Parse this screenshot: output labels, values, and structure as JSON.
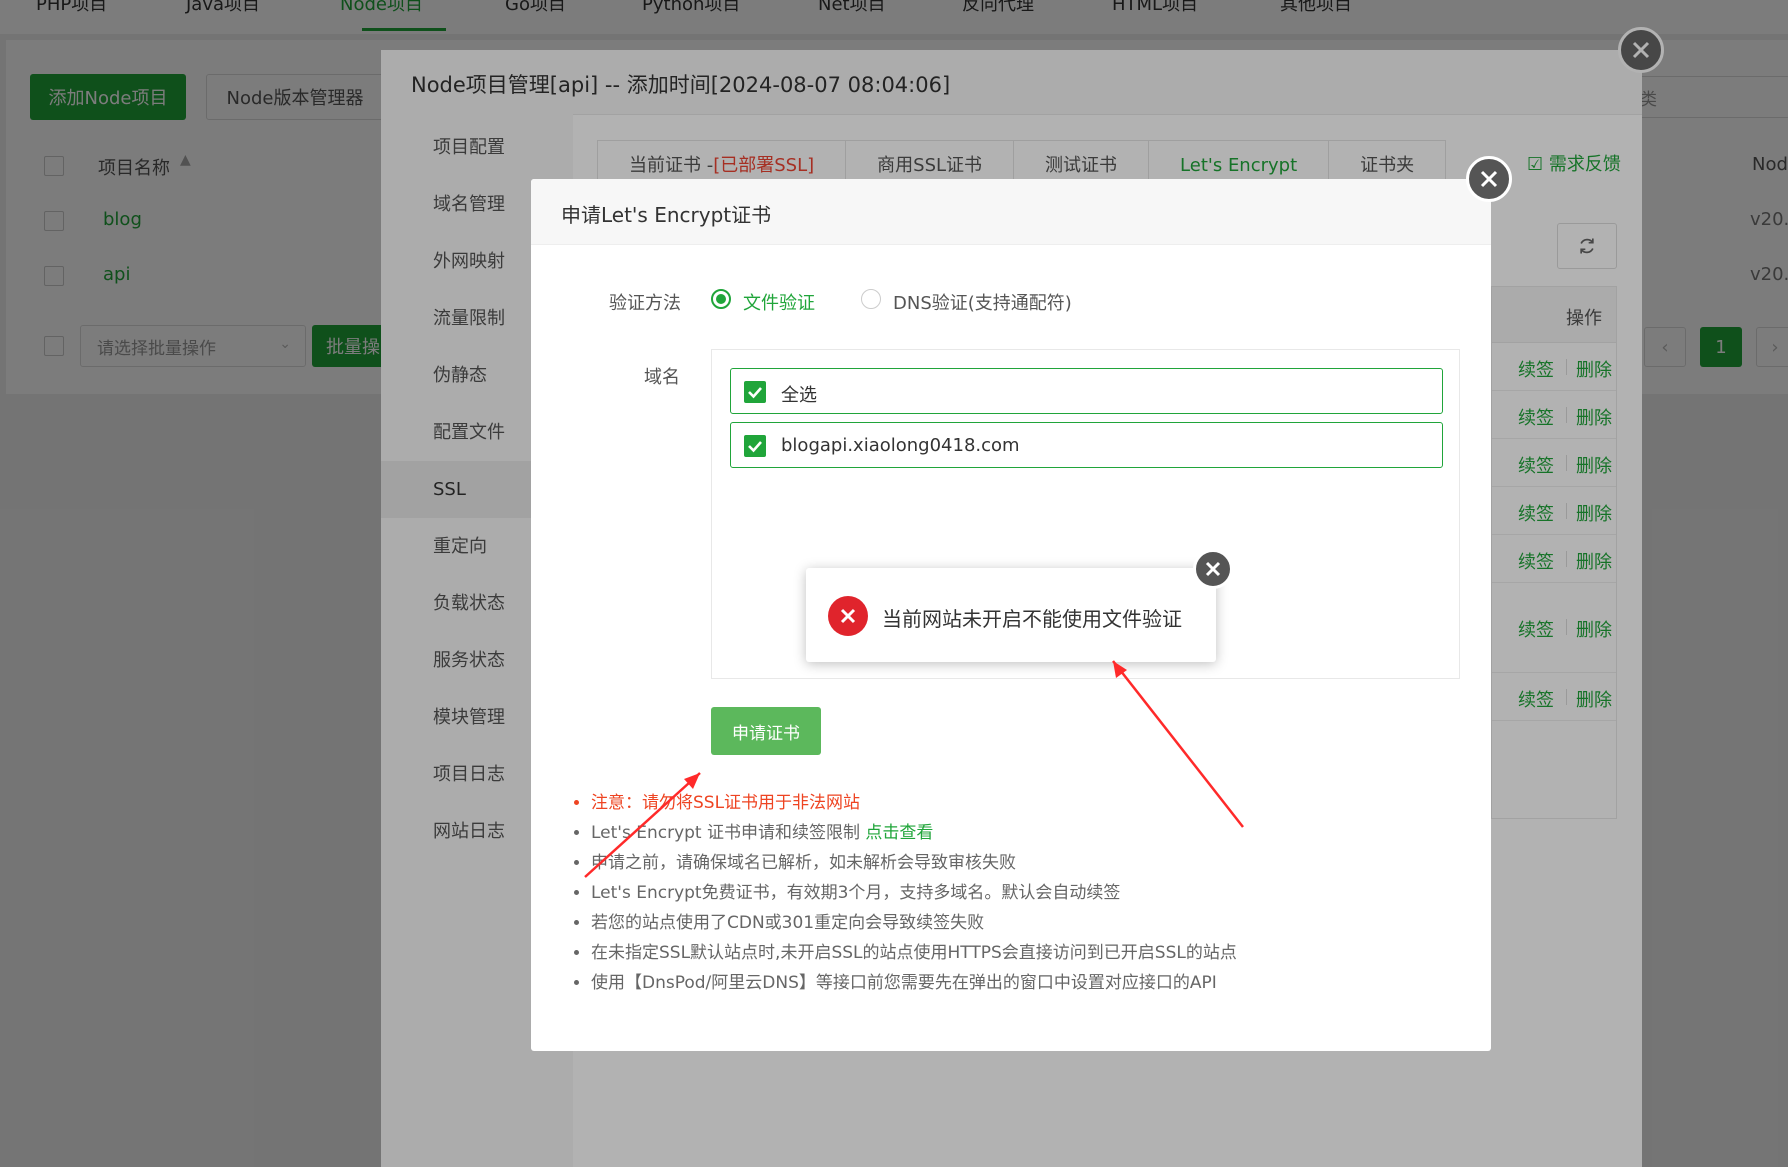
{
  "top_nav": {
    "tabs": [
      "PHP项目",
      "Java项目",
      "Node项目",
      "Go项目",
      "Python项目",
      "Net项目",
      "反向代理",
      "HTML项目",
      "其他项目"
    ],
    "active": "Node项目"
  },
  "toolbar": {
    "add_node": "添加Node项目",
    "node_version": "Node版本管理器",
    "category_select": "分类"
  },
  "project_table": {
    "col_name": "项目名称",
    "col_node": "Nod",
    "rows": [
      {
        "name": "blog",
        "node": "v20."
      },
      {
        "name": "api",
        "node": "v20."
      }
    ],
    "batch_placeholder": "请选择批量操作",
    "batch_button": "批量操",
    "page": "1"
  },
  "panel": {
    "title": "Node项目管理[api] -- 添加时间[2024-08-07 08:04:06]",
    "menu": [
      "项目配置",
      "域名管理",
      "外网映射",
      "流量限制",
      "伪静态",
      "配置文件",
      "SSL",
      "重定向",
      "负载状态",
      "服务状态",
      "模块管理",
      "项目日志",
      "网站日志"
    ],
    "active_menu": "SSL",
    "ssl_tabs": {
      "current_prefix": "当前证书 -",
      "current_status": "[已部署SSL]",
      "commercial": "商用SSL证书",
      "test": "测试证书",
      "letsencrypt": "Let's Encrypt",
      "folder": "证书夹"
    },
    "feedback": "需求反馈",
    "ops_header": "操作",
    "row_actions": {
      "renew": "续签",
      "delete": "删除"
    },
    "row_count": 7
  },
  "dialog": {
    "title": "申请Let's Encrypt证书",
    "verify_label": "验证方法",
    "verify_file": "文件验证",
    "verify_dns": "DNS验证(支持通配符)",
    "verify_selected": "文件验证",
    "domain_label": "域名",
    "select_all": "全选",
    "domain": "blogapi.xiaolong0418.com",
    "apply_button": "申请证书",
    "notes": {
      "warning": "注意：请勿将SSL证书用于非法网站",
      "limit_text": "Let's Encrypt 证书申请和续签限制 ",
      "limit_link": "点击查看",
      "n3": "申请之前，请确保域名已解析，如未解析会导致审核失败",
      "n4": "Let's Encrypt免费证书，有效期3个月，支持多域名。默认会自动续签",
      "n5": "若您的站点使用了CDN或301重定向会导致续签失败",
      "n6": "在未指定SSL默认站点时,未开启SSL的站点使用HTTPS会直接访问到已开启SSL的站点",
      "n7": "使用【DnsPod/阿里云DNS】等接口前您需要先在弹出的窗口中设置对应接口的API"
    }
  },
  "toast": {
    "message": "当前网站未开启不能使用文件验证"
  },
  "colors": {
    "brand_green": "#20a53a",
    "error_red": "#e0242c",
    "warning_red": "#e42222",
    "annotation_arrow": "#ff2a2a"
  }
}
